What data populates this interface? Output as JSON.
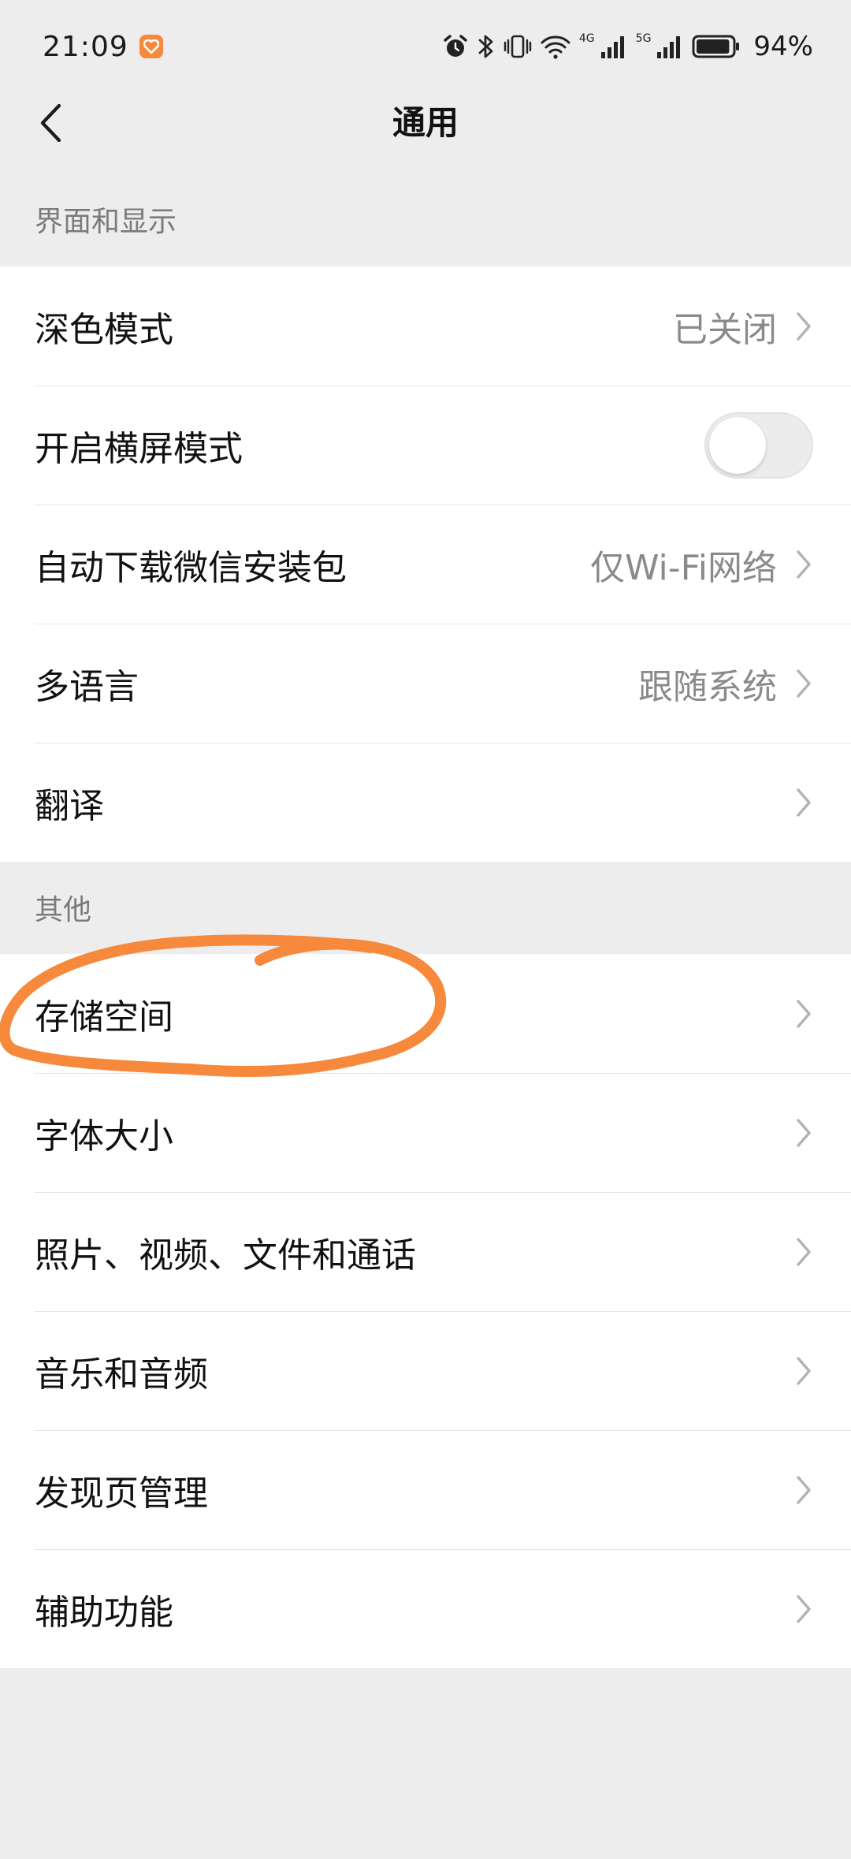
{
  "status_bar": {
    "time": "21:09",
    "net1": "4G",
    "net2": "5G",
    "battery": "94%",
    "battery_level": 0.94,
    "icons": [
      "app-badge-icon",
      "alarm-icon",
      "bluetooth-icon",
      "vibrate-icon",
      "wifi-icon",
      "signal-icon",
      "battery-icon"
    ]
  },
  "nav": {
    "title": "通用",
    "back_icon": "chevron-left-icon"
  },
  "sections": {
    "display": {
      "header": "界面和显示",
      "items": [
        {
          "label": "深色模式",
          "value": "已关闭"
        },
        {
          "label": "开启横屏模式",
          "toggle_on": false
        },
        {
          "label": "自动下载微信安装包",
          "value": "仅Wi-Fi网络"
        },
        {
          "label": "多语言",
          "value": "跟随系统"
        },
        {
          "label": "翻译"
        }
      ]
    },
    "other": {
      "header": "其他",
      "items": [
        {
          "label": "存储空间"
        },
        {
          "label": "字体大小"
        },
        {
          "label": "照片、视频、文件和通话"
        },
        {
          "label": "音乐和音频"
        },
        {
          "label": "发现页管理"
        },
        {
          "label": "辅助功能"
        }
      ]
    }
  },
  "colors": {
    "background": "#ededed",
    "card": "#ffffff",
    "annotation": "#f6893b",
    "secondary_text": "#8a8a8a"
  }
}
